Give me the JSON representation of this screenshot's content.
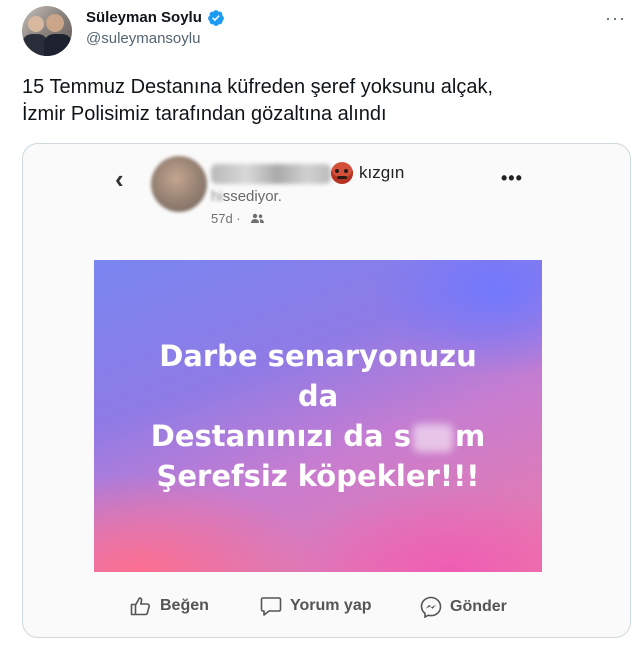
{
  "author": {
    "name": "Süleyman Soylu",
    "handle": "@suleymansoylu",
    "verified": true,
    "verified_color": "#1d9bf0"
  },
  "tweet": {
    "text_line1": "15 Temmuz Destanına küfreden şeref yoksunu alçak,",
    "text_line2": "İzmir Polisimiz tarafından gözaltına alındı",
    "more_icon": "more-horizontal-icon"
  },
  "facebook_post": {
    "feeling": "kızgın",
    "feeling_line2_visible": "ssediyor.",
    "time": "57d ·",
    "image_text": {
      "line1": "Darbe senaryonuzu",
      "line2": "da",
      "line3_start": "Destanınızı da s",
      "line3_end": "m",
      "line4": "Şerefsiz köpekler!!!"
    },
    "actions": {
      "like": "Beğen",
      "comment": "Yorum yap",
      "send": "Gönder"
    }
  }
}
